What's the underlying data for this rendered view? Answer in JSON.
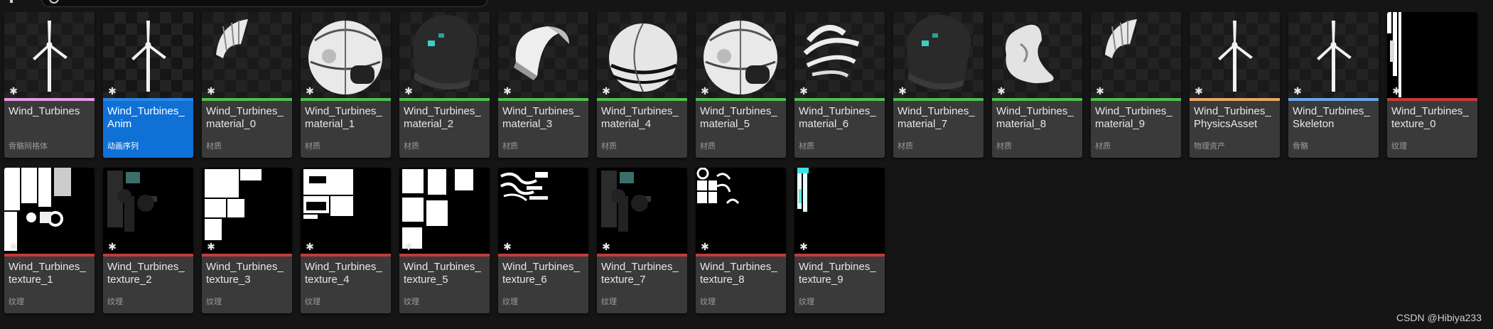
{
  "colors": {
    "skeletal_mesh": "#e49be8",
    "anim": "#2d86e6",
    "material": "#4fbe4c",
    "physics": "#e8a768",
    "skeleton": "#6aa6e8",
    "texture": "#c43a3a"
  },
  "assets": [
    {
      "name": "Wind_Turbines",
      "type": "骨骼网格体",
      "kind": "skeletal_mesh",
      "icon": "turbine-icon"
    },
    {
      "name": "Wind_Turbines_Anim",
      "type": "动画序列",
      "kind": "anim",
      "icon": "turbine-icon",
      "selected": true
    },
    {
      "name": "Wind_Turbines_material_0",
      "type": "材质",
      "kind": "material",
      "icon": "material-fragment-icon"
    },
    {
      "name": "Wind_Turbines_material_1",
      "type": "材质",
      "kind": "material",
      "icon": "material-sphere-icon"
    },
    {
      "name": "Wind_Turbines_material_2",
      "type": "材质",
      "kind": "material",
      "icon": "material-dark-shell-icon"
    },
    {
      "name": "Wind_Turbines_material_3",
      "type": "材质",
      "kind": "material",
      "icon": "material-shell-icon"
    },
    {
      "name": "Wind_Turbines_material_4",
      "type": "材质",
      "kind": "material",
      "icon": "material-striped-sphere-icon"
    },
    {
      "name": "Wind_Turbines_material_5",
      "type": "材质",
      "kind": "material",
      "icon": "material-sphere-icon"
    },
    {
      "name": "Wind_Turbines_material_6",
      "type": "材质",
      "kind": "material",
      "icon": "material-striped-fragment-icon"
    },
    {
      "name": "Wind_Turbines_material_7",
      "type": "材质",
      "kind": "material",
      "icon": "material-dark-shell-icon"
    },
    {
      "name": "Wind_Turbines_material_8",
      "type": "材质",
      "kind": "material",
      "icon": "material-blob-icon"
    },
    {
      "name": "Wind_Turbines_material_9",
      "type": "材质",
      "kind": "material",
      "icon": "material-fragment-icon"
    },
    {
      "name": "Wind_Turbines_PhysicsAsset",
      "type": "物理资产",
      "kind": "physics",
      "icon": "turbine-icon"
    },
    {
      "name": "Wind_Turbines_Skeleton",
      "type": "骨骼",
      "kind": "skeleton",
      "icon": "turbine-icon"
    },
    {
      "name": "Wind_Turbines_texture_0",
      "type": "纹理",
      "kind": "texture",
      "icon": "texture-strip-icon"
    },
    {
      "name": "Wind_Turbines_texture_1",
      "type": "纹理",
      "kind": "texture",
      "icon": "texture-uv-icon"
    },
    {
      "name": "Wind_Turbines_texture_2",
      "type": "纹理",
      "kind": "texture",
      "icon": "texture-dark-icon"
    },
    {
      "name": "Wind_Turbines_texture_3",
      "type": "纹理",
      "kind": "texture",
      "icon": "texture-blocks-icon"
    },
    {
      "name": "Wind_Turbines_texture_4",
      "type": "纹理",
      "kind": "texture",
      "icon": "texture-blocks-icon"
    },
    {
      "name": "Wind_Turbines_texture_5",
      "type": "纹理",
      "kind": "texture",
      "icon": "texture-blocks-icon"
    },
    {
      "name": "Wind_Turbines_texture_6",
      "type": "纹理",
      "kind": "texture",
      "icon": "texture-swirl-icon"
    },
    {
      "name": "Wind_Turbines_texture_7",
      "type": "纹理",
      "kind": "texture",
      "icon": "texture-dark-icon"
    },
    {
      "name": "Wind_Turbines_texture_8",
      "type": "纹理",
      "kind": "texture",
      "icon": "texture-circles-icon"
    },
    {
      "name": "Wind_Turbines_texture_9",
      "type": "纹理",
      "kind": "texture",
      "icon": "texture-cyan-strip-icon"
    }
  ],
  "watermark": "CSDN @Hibiya233"
}
